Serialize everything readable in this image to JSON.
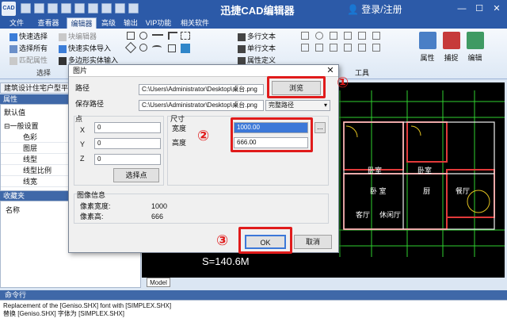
{
  "app": {
    "icon_text": "CAD",
    "title": "迅捷CAD编辑器",
    "user_label": "登录/注册"
  },
  "menu_tabs": [
    "文件",
    "查看器",
    "编辑器",
    "高级",
    "输出",
    "VIP功能",
    "相关软件"
  ],
  "ribbon": {
    "select_group": [
      "快速选择",
      "选择所有",
      "匹配属性"
    ],
    "select_group_label": "选择",
    "block_group": [
      "块编辑器",
      "快速实体导入",
      "多边形实体输入"
    ],
    "text_group": [
      "多行文本",
      "单行文本",
      "属性定义"
    ],
    "tools_label": "工具",
    "big_buttons": [
      "属性",
      "捕捉",
      "编辑"
    ]
  },
  "left_panel": {
    "doc_tab": "建筑设计住宅户型平面",
    "properties_header": "属性",
    "default_value": "默认值",
    "general_section": "一般设置",
    "props": [
      "色彩",
      "图层",
      "线型",
      "线型比例",
      "线宽"
    ],
    "favorites_header": "收藏夹",
    "name_label": "名称"
  },
  "drawing": {
    "rooms": [
      "卧室",
      "卧室",
      "卧 室",
      "厨",
      "餐厅",
      "客厅",
      "休闲厅"
    ],
    "area_text": "S=140.6M",
    "model_tab": "Model"
  },
  "command": {
    "header": "命令行",
    "lines": [
      "Replacement of the [Geniso.SHX] font with [SIMPLEX.SHX]",
      "替换 [Geniso.SHX] 字体为 [SIMPLEX.SHX]"
    ]
  },
  "dialog": {
    "title": "图片",
    "path_label": "路径",
    "path_value": "C:\\Users\\Administrator\\Desktop\\桌台.png",
    "browse_button": "浏览",
    "save_path_label": "保存路径",
    "save_path_value": "C:\\Users\\Administrator\\Desktop\\桌台.png",
    "save_mode": "完整路径",
    "point_label": "点",
    "x_label": "X",
    "x_value": "0",
    "y_label": "Y",
    "y_value": "0",
    "z_label": "Z",
    "z_value": "0",
    "select_point_button": "选择点",
    "size_label": "尺寸",
    "width_label": "宽度",
    "width_value": "1000.00",
    "height_label": "高度",
    "height_value": "666.00",
    "size_browse": "...",
    "image_info_label": "图像信息",
    "pixel_width_label": "像素宽度:",
    "pixel_width_value": "1000",
    "pixel_height_label": "像素高:",
    "pixel_height_value": "666",
    "ok_button": "OK",
    "cancel_button": "取消"
  },
  "markers": [
    "①",
    "②",
    "③"
  ],
  "colors": {
    "title_bar": "#2c5aa8",
    "panel_header": "#3f68a8",
    "highlight_red": "#e01b1b",
    "canvas_bg": "#000000"
  }
}
